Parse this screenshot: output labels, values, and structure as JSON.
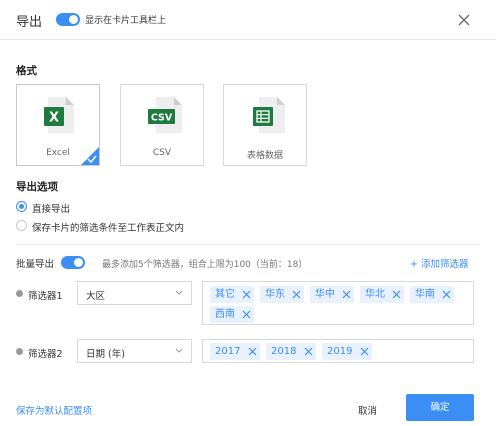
{
  "header": {
    "title": "导出",
    "toggle_label": "显示在卡片工具栏上",
    "toggle_on": true
  },
  "format": {
    "title": "格式",
    "options": [
      {
        "label": "Excel",
        "badge": "X",
        "icon": "excel-icon",
        "selected": true
      },
      {
        "label": "CSV",
        "badge": "CSV",
        "icon": "csv-icon",
        "selected": false
      },
      {
        "label": "表格数据",
        "badge": "",
        "icon": "table-data-icon",
        "selected": false
      }
    ]
  },
  "export_options": {
    "title": "导出选项",
    "radios": [
      {
        "label": "直接导出",
        "checked": true
      },
      {
        "label": "保存卡片的筛选条件至工作表正文内",
        "checked": false
      }
    ]
  },
  "batch": {
    "label": "批量导出",
    "toggle_on": true,
    "hint": "最多添加5个筛选器，组合上限为100（当前：18）",
    "add_filter": "+ 添加筛选器"
  },
  "filters": [
    {
      "name": "筛选器1",
      "field": "大区",
      "values": [
        "其它",
        "华东",
        "华中",
        "华北",
        "华南",
        "西南"
      ]
    },
    {
      "name": "筛选器2",
      "field": "日期 (年)",
      "values": [
        "2017",
        "2018",
        "2019"
      ]
    }
  ],
  "footer": {
    "save_default": "保存为默认配置项",
    "cancel": "取消",
    "ok": "确定"
  },
  "colors": {
    "accent": "#3b8ff4",
    "excel_green": "#1e7a3e",
    "tag_bg": "#e8f1fd"
  }
}
